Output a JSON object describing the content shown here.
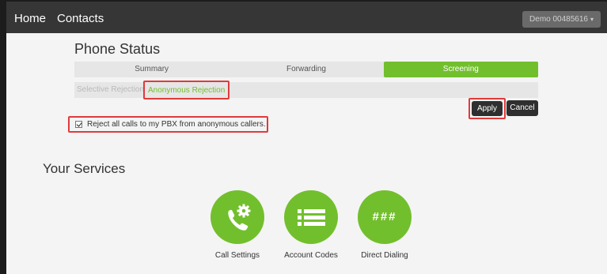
{
  "nav": {
    "home": "Home",
    "contacts": "Contacts",
    "account": "Demo 00485616"
  },
  "phone_status": {
    "title": "Phone Status",
    "tabs": [
      {
        "label": "Summary",
        "active": false
      },
      {
        "label": "Forwarding",
        "active": false
      },
      {
        "label": "Screening",
        "active": true
      }
    ],
    "subtabs": {
      "selective": "Selective Rejection",
      "anonymous": "Anonymous Rejection"
    },
    "apply_label": "Apply",
    "cancel_label": "Cancel",
    "reject_label": "Reject all calls to my PBX from anonymous callers.",
    "reject_checked": true
  },
  "services": {
    "title": "Your Services",
    "items": [
      {
        "label": "Call Settings",
        "icon": "phone-gear-icon"
      },
      {
        "label": "Account Codes",
        "icon": "list-icon"
      },
      {
        "label": "Direct Dialing",
        "icon": "hash-icon",
        "glyph": "###"
      }
    ]
  },
  "colors": {
    "accent_green": "#72bf2d",
    "highlight_red": "#e03a3a",
    "navbar": "#363636"
  }
}
